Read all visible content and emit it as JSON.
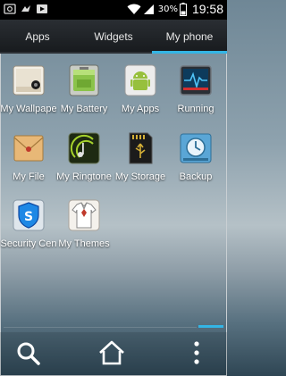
{
  "status_bar": {
    "battery_percent": "30%",
    "time": "19:58",
    "icons": [
      "photo-icon",
      "bird-icon",
      "play-icon",
      "wifi-icon",
      "signal-icon",
      "battery-icon"
    ]
  },
  "tabs": [
    {
      "label": "Apps",
      "active": false
    },
    {
      "label": "Widgets",
      "active": false
    },
    {
      "label": "My phone",
      "active": true
    }
  ],
  "apps": [
    {
      "label": "My Wallpape",
      "icon": "wallpaper-icon"
    },
    {
      "label": "My Battery",
      "icon": "battery-app-icon"
    },
    {
      "label": "My Apps",
      "icon": "android-apps-icon"
    },
    {
      "label": "Running",
      "icon": "running-monitor-icon"
    },
    {
      "label": "My File",
      "icon": "folder-envelope-icon"
    },
    {
      "label": "My Ringtone",
      "icon": "ringtone-icon"
    },
    {
      "label": "My Storage",
      "icon": "sd-card-icon"
    },
    {
      "label": "Backup",
      "icon": "backup-clock-icon"
    },
    {
      "label": "Security Cen",
      "icon": "security-shield-icon"
    },
    {
      "label": "My Themes",
      "icon": "themes-shirt-icon"
    }
  ],
  "bottom_nav": {
    "icons": [
      "search-icon",
      "home-icon",
      "menu-dots-icon"
    ]
  },
  "colors": {
    "accent": "#33b5e5",
    "tabbar": "#1e2226",
    "statusbar": "#000000"
  }
}
